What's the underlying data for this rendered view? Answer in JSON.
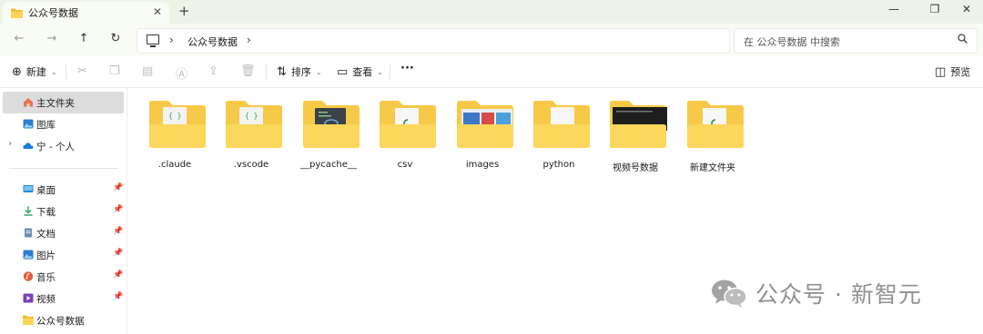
{
  "tab": {
    "title": "公众号数据",
    "close": "✕",
    "new": "+"
  },
  "window": {
    "minimize": "—",
    "maximize": "❐",
    "close": "✕"
  },
  "nav": {
    "back": "←",
    "forward": "→",
    "up": "↑",
    "refresh": "↻"
  },
  "address": {
    "sep": "›",
    "crumb": "公众号数据"
  },
  "search": {
    "placeholder": "在 公众号数据 中搜索"
  },
  "toolbar": {
    "new_label": "新建",
    "sort_label": "排序",
    "view_label": "查看",
    "more": "···",
    "preview_label": "预览"
  },
  "sidebar": {
    "items": [
      {
        "label": "主文件夹",
        "icon": "home-icon"
      },
      {
        "label": "图库",
        "icon": "gallery-icon"
      },
      {
        "label": "宁 - 个人",
        "icon": "cloud-icon"
      },
      {
        "label": "桌面",
        "icon": "desktop-icon"
      },
      {
        "label": "下载",
        "icon": "download-icon"
      },
      {
        "label": "文档",
        "icon": "document-icon"
      },
      {
        "label": "图片",
        "icon": "pictures-icon"
      },
      {
        "label": "音乐",
        "icon": "music-icon"
      },
      {
        "label": "视频",
        "icon": "video-icon"
      },
      {
        "label": "公众号数据",
        "icon": "folder-icon"
      }
    ]
  },
  "folders": [
    {
      "name": ".claude",
      "preview": "code"
    },
    {
      "name": ".vscode",
      "preview": "code"
    },
    {
      "name": "__pycache__",
      "preview": "pyfile"
    },
    {
      "name": "csv",
      "preview": "doc"
    },
    {
      "name": "images",
      "preview": "image"
    },
    {
      "name": "python",
      "preview": "page"
    },
    {
      "name": "视频号数据",
      "preview": "video"
    },
    {
      "name": "新建文件夹",
      "preview": "doc"
    }
  ],
  "watermark": {
    "text": "公众号 · 新智元"
  },
  "colors": {
    "folder": "#f7c948",
    "folder_front": "#fbd75b",
    "selection": "#dcdcdc",
    "accent": "#0067c0"
  }
}
